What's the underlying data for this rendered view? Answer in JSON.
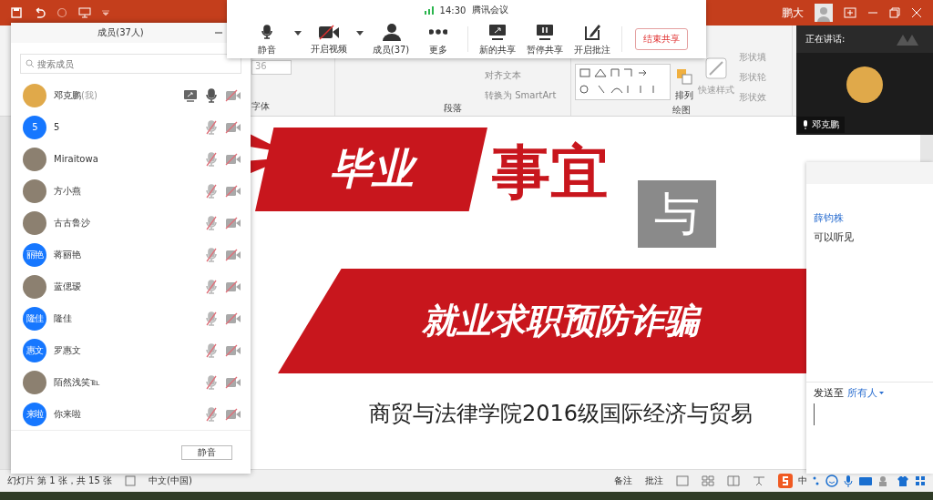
{
  "ppt": {
    "user_name": "鹏大",
    "ribbon": {
      "font_size": "36",
      "groups": [
        "字体",
        "段落",
        "绘图"
      ],
      "paragraph_commands": [
        "对齐文本",
        "转换为 SmartArt"
      ],
      "arrange": "排列",
      "quick_styles": "快速样式",
      "shape_commands": [
        "形状填",
        "形状轮",
        "形状效"
      ]
    },
    "slide": {
      "title_1": "毕业",
      "title_2": "事宜",
      "title_3": "与",
      "banner": "就业求职预防诈骗",
      "subtitle": "商贸与法律学院2016级国际经济与贸易"
    },
    "status_bar": {
      "slide_info": "幻灯片 第 1 张，共 15 张",
      "language": "中文(中国)",
      "notes": "备注",
      "comments": "批注",
      "ime": "中"
    }
  },
  "members_panel": {
    "title": "成员(37人)",
    "search": {
      "placeholder": "搜索成员"
    },
    "members": [
      {
        "name": "邓克鹏",
        "tag": "(我)",
        "avatar": {
          "kind": "photo"
        },
        "sharing": true,
        "muted": false,
        "video_on": false
      },
      {
        "name": "5",
        "avatar": {
          "kind": "initials",
          "text": "5"
        },
        "sharing": false,
        "muted": true,
        "video_on": false
      },
      {
        "name": "Miraitowa",
        "avatar": {
          "kind": "photo"
        },
        "sharing": false,
        "muted": true,
        "video_on": false
      },
      {
        "name": "方小燕",
        "avatar": {
          "kind": "photo"
        },
        "sharing": false,
        "muted": true,
        "video_on": false
      },
      {
        "name": "古古鲁沙",
        "avatar": {
          "kind": "photo"
        },
        "sharing": false,
        "muted": true,
        "video_on": false
      },
      {
        "name": "蒋丽艳",
        "avatar": {
          "kind": "initials",
          "text": "丽艳"
        },
        "sharing": false,
        "muted": true,
        "video_on": false
      },
      {
        "name": "蓝偲瑷",
        "avatar": {
          "kind": "photo"
        },
        "sharing": false,
        "muted": true,
        "video_on": false
      },
      {
        "name": "隆佳",
        "avatar": {
          "kind": "initials",
          "text": "隆佳"
        },
        "sharing": false,
        "muted": true,
        "video_on": false
      },
      {
        "name": "罗惠文",
        "avatar": {
          "kind": "initials",
          "text": "惠文"
        },
        "sharing": false,
        "muted": true,
        "video_on": false
      },
      {
        "name": "陌然浅笑℡",
        "avatar": {
          "kind": "photo"
        },
        "sharing": false,
        "muted": true,
        "video_on": false
      },
      {
        "name": "你来啦",
        "avatar": {
          "kind": "initials",
          "text": "来啦"
        },
        "sharing": false,
        "muted": true,
        "video_on": false
      }
    ],
    "mute_all": "静音"
  },
  "meeting_toolbar": {
    "time": "14:30",
    "title": "腾讯会议",
    "buttons": [
      {
        "kind": "mic",
        "label": "静音"
      },
      {
        "kind": "video",
        "label": "开启视频"
      },
      {
        "kind": "members",
        "label": "成员(37)"
      },
      {
        "kind": "more",
        "label": "更多"
      },
      {
        "kind": "new-share",
        "label": "新的共享"
      },
      {
        "kind": "pause",
        "label": "暂停共享"
      },
      {
        "kind": "annotate",
        "label": "开启批注"
      }
    ],
    "end_share": "结束共享"
  },
  "speaker_panel": {
    "heading": "正在讲话:",
    "name": "邓克鹏"
  },
  "chat": {
    "messages": [
      {
        "sender": "薛钧株",
        "text": "可以听见"
      }
    ],
    "send_to_label": "发送至",
    "recipient": "所有人"
  }
}
